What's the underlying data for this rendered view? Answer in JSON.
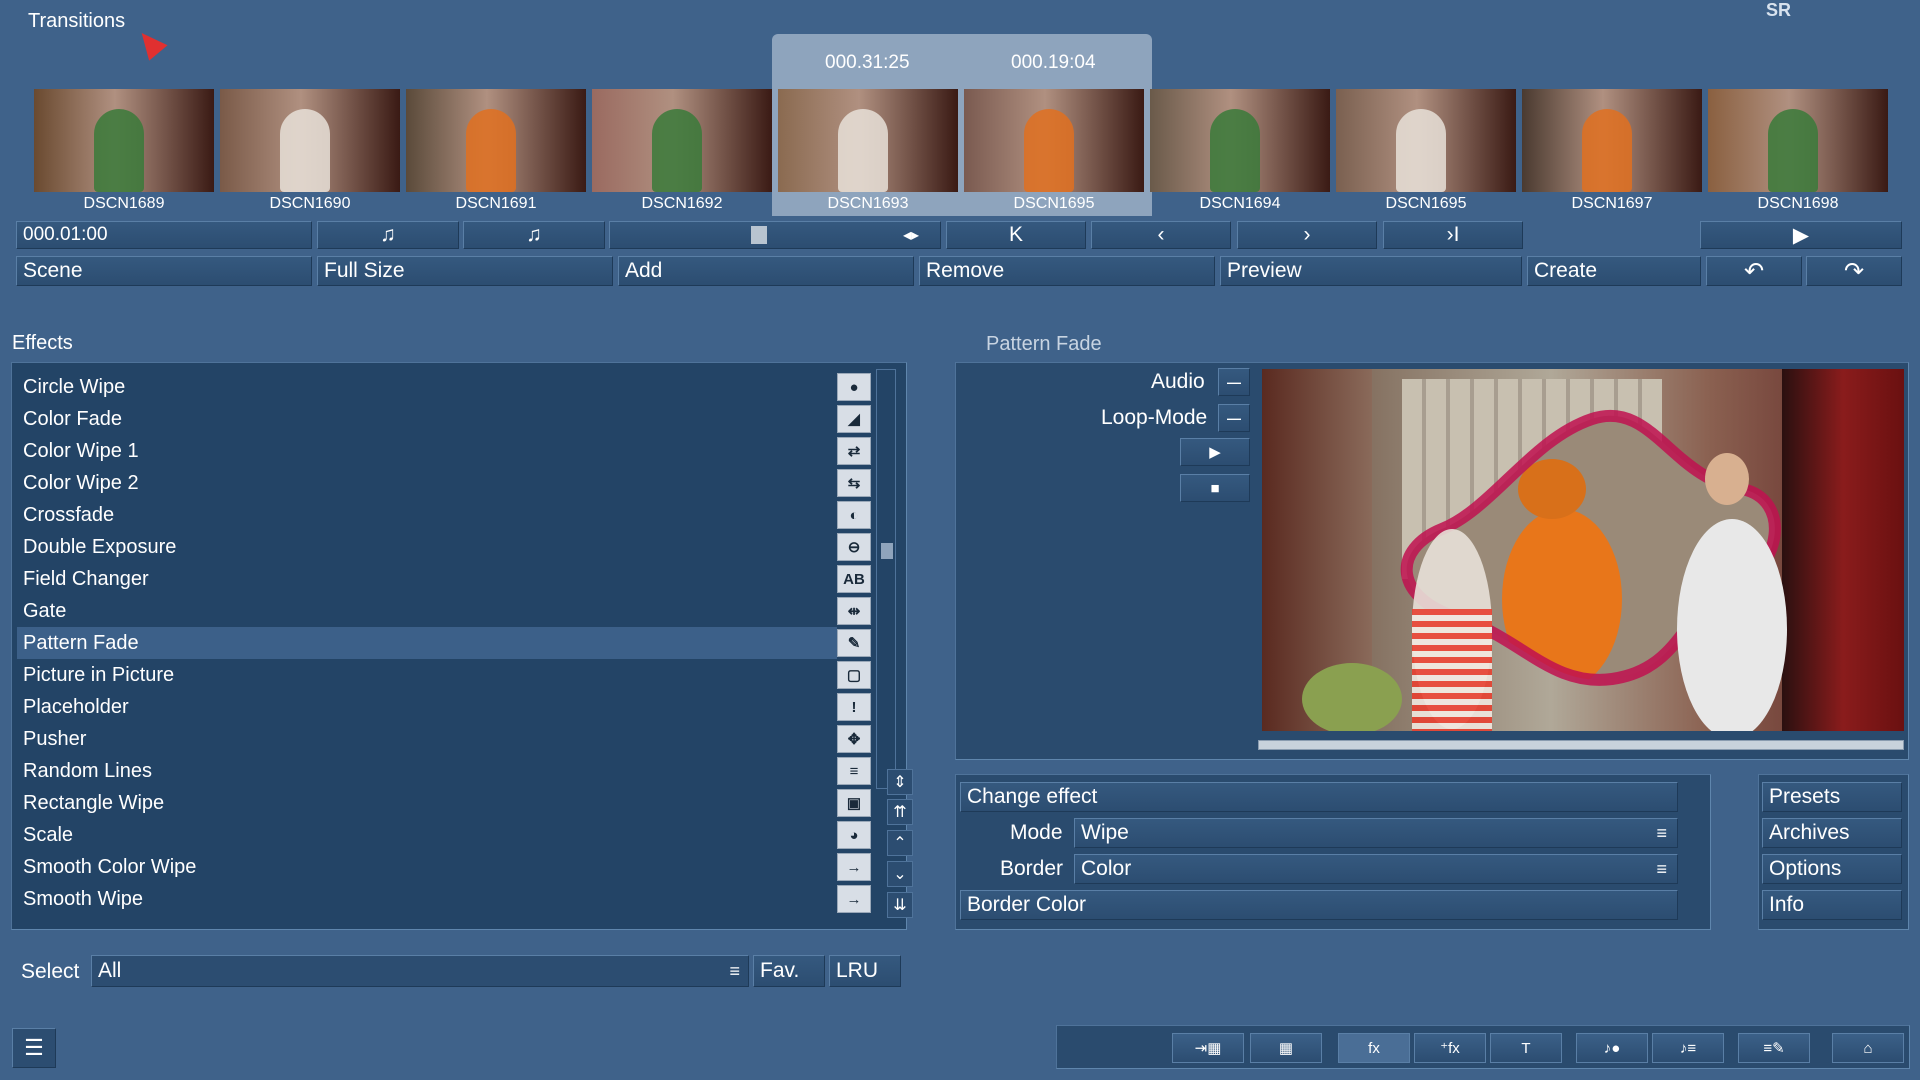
{
  "app": {
    "title": "Transitions",
    "badge": "SR"
  },
  "timecodes": {
    "left": "000.31:25",
    "right": "000.19:04"
  },
  "thumbnails": [
    {
      "label": "DSCN1689",
      "color": "#6a4a30"
    },
    {
      "label": "DSCN1690",
      "color": "#7a5a48"
    },
    {
      "label": "DSCN1691",
      "color": "#5a4a3a"
    },
    {
      "label": "DSCN1692",
      "color": "#9a6a60"
    },
    {
      "label": "DSCN1693",
      "color": "#8a6a50"
    },
    {
      "label": "DSCN1695",
      "color": "#7a5a50"
    },
    {
      "label": "DSCN1694",
      "color": "#6a5a4a"
    },
    {
      "label": "DSCN1695",
      "color": "#7a6050"
    },
    {
      "label": "DSCN1697",
      "color": "#4a3a30"
    },
    {
      "label": "DSCN1698",
      "color": "#8a6040"
    }
  ],
  "transport": {
    "timecode": "000.01:00",
    "music_icon": "♫",
    "music_icon2": "♫",
    "split_icon": "◂▸",
    "first_icon": "K",
    "prev_icon": "‹",
    "next_icon": "›",
    "last_icon": "›I",
    "play_icon": "▶"
  },
  "toolbar": {
    "scene": "Scene",
    "full_size": "Full Size",
    "add": "Add",
    "remove": "Remove",
    "preview": "Preview",
    "create": "Create",
    "undo_icon": "↶",
    "redo_icon": "↷"
  },
  "effects": {
    "heading": "Effects",
    "items": [
      {
        "label": "Circle Wipe",
        "icon": "●"
      },
      {
        "label": "Color Fade",
        "icon": "◢"
      },
      {
        "label": "Color Wipe 1",
        "icon": "⇄"
      },
      {
        "label": "Color Wipe 2",
        "icon": "⇆"
      },
      {
        "label": "Crossfade",
        "icon": "◐"
      },
      {
        "label": "Double Exposure",
        "icon": "⊖"
      },
      {
        "label": "Field Changer",
        "icon": "AB"
      },
      {
        "label": "Gate",
        "icon": "⇹"
      },
      {
        "label": "Pattern Fade",
        "icon": "✎"
      },
      {
        "label": "Picture in Picture",
        "icon": "▢"
      },
      {
        "label": "Placeholder",
        "icon": "!"
      },
      {
        "label": "Pusher",
        "icon": "✥"
      },
      {
        "label": "Random Lines",
        "icon": "≡"
      },
      {
        "label": "Rectangle Wipe",
        "icon": "▣"
      },
      {
        "label": "Scale",
        "icon": "◕"
      },
      {
        "label": "Smooth Color Wipe",
        "icon": "→"
      },
      {
        "label": "Smooth Wipe",
        "icon": "→"
      }
    ],
    "selected": "Pattern Fade",
    "select_label": "Select",
    "select_value": "All",
    "fav": "Fav.",
    "lru": "LRU"
  },
  "pattern_fade": {
    "heading": "Pattern Fade",
    "audio_label": "Audio",
    "loop_label": "Loop-Mode",
    "minus": "—",
    "play_icon": "▶",
    "stop_icon": "■",
    "change_effect": "Change effect",
    "mode_label": "Mode",
    "mode_value": "Wipe",
    "border_label": "Border",
    "border_value": "Color",
    "border_color": "Border Color",
    "menu_icon": "≡"
  },
  "side": {
    "presets": "Presets",
    "archives": "Archives",
    "options": "Options",
    "info": "Info"
  },
  "colors": {
    "background": "#3f628a",
    "panel": "#234466",
    "selected_row": "#3c6089",
    "border_shape": "#c01050"
  }
}
